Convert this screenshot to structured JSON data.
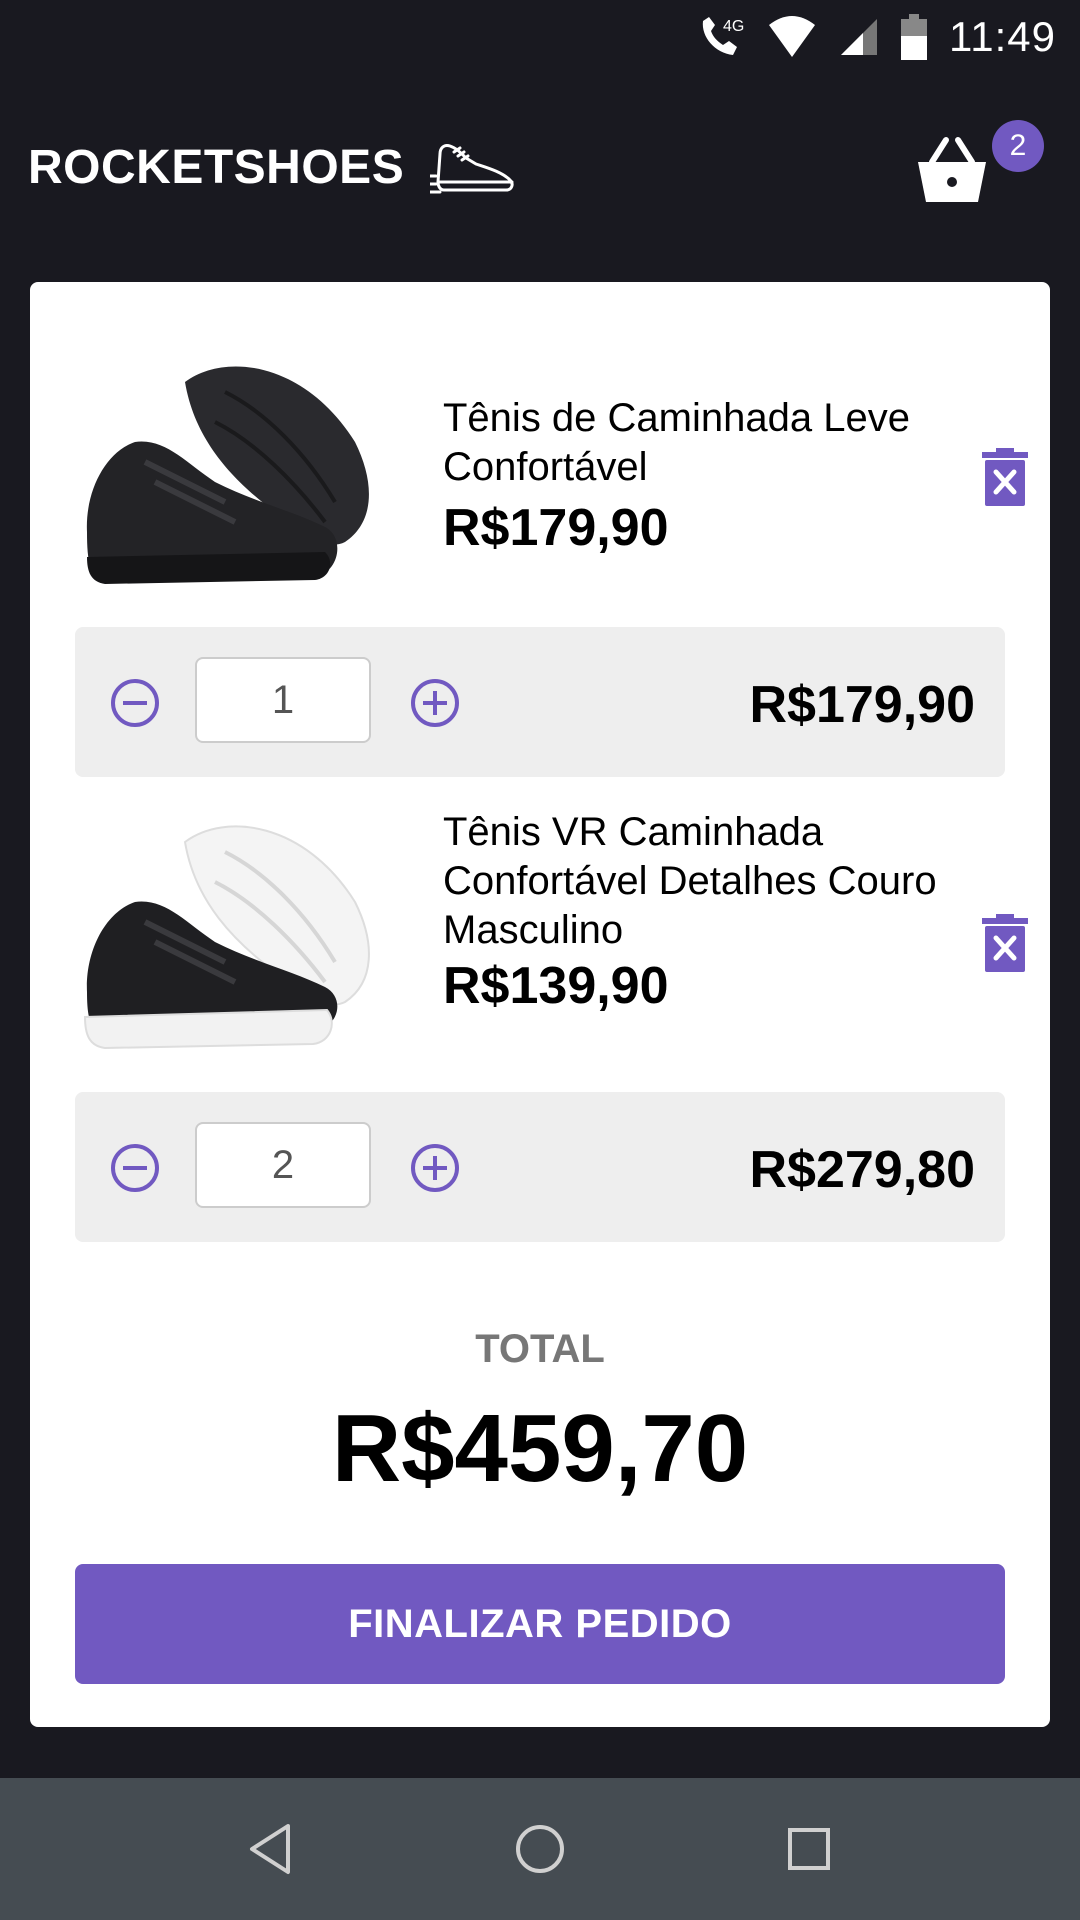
{
  "status_bar": {
    "network": "4G",
    "time": "11:49"
  },
  "header": {
    "logo_text": "ROCKETSHOES",
    "cart_count": "2"
  },
  "cart": {
    "items": [
      {
        "title": "Tênis de Caminhada Leve Confortável",
        "price": "R$179,90",
        "quantity": "1",
        "subtotal": "R$179,90",
        "image_icon": "black-sneaker-black-sole"
      },
      {
        "title": "Tênis VR Caminhada Confortável Detalhes Couro Masculino",
        "price": "R$139,90",
        "quantity": "2",
        "subtotal": "R$279,80",
        "image_icon": "black-sneaker-white-sole"
      }
    ],
    "total_label": "TOTAL",
    "total_value": "R$459,70",
    "checkout_label": "FINALIZAR PEDIDO"
  },
  "colors": {
    "background": "#191920",
    "accent": "#7159c1",
    "panel": "#eeeeee",
    "nav_bar": "#454c52"
  }
}
